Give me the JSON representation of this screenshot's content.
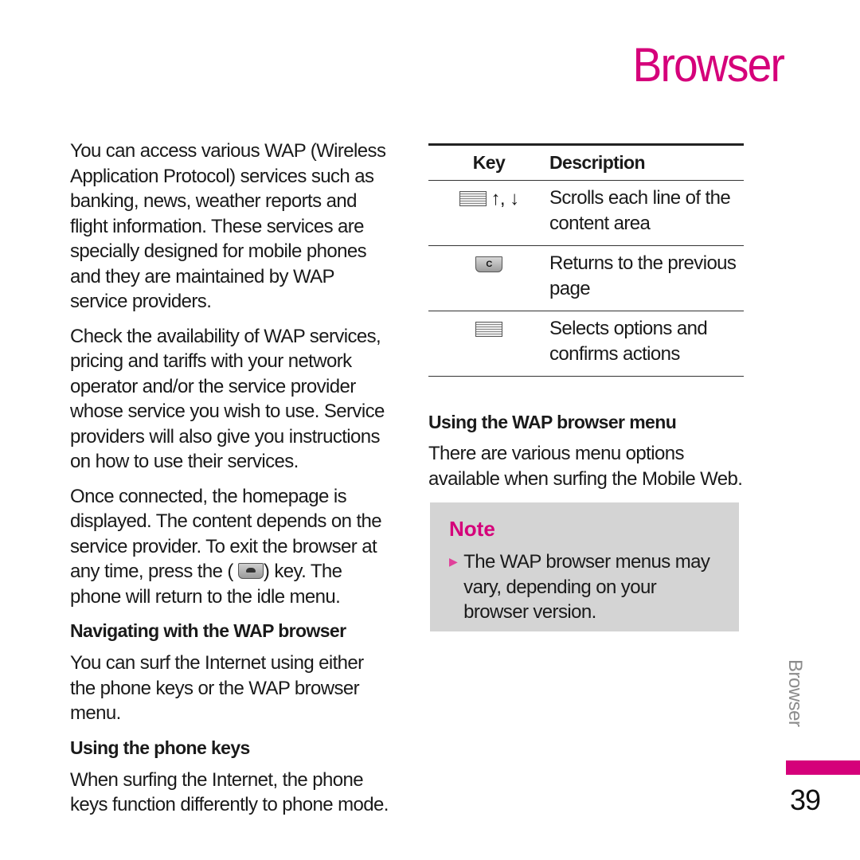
{
  "page": {
    "title": "Browser",
    "side_label": "Browser",
    "page_number": "39",
    "accent_color": "#d5007a"
  },
  "left": {
    "intro_1": "You can access various WAP (Wireless Application Protocol) services such as banking, news, weather reports and flight information. These services are specially designed for mobile phones and they are maintained by WAP service providers.",
    "intro_2": "Check the availability of WAP services, pricing and tariffs with your network operator and/or the service provider whose service you wish to use. Service providers will also give you instructions on how to use their services.",
    "intro_3_before": "Once connected, the homepage is displayed. The content depends on the service provider. To exit the browser at any time, press the (",
    "intro_3_key_icon": "end-call-key-icon",
    "intro_3_after": ") key. The phone will return to the idle menu.",
    "heading_navigating": "Navigating with the WAP browser",
    "navigating_text": "You can surf the Internet using either the phone keys or the WAP browser menu.",
    "heading_phone_keys": "Using the phone keys",
    "phone_keys_text": "When surfing the Internet, the phone keys function differently to phone mode."
  },
  "key_table": {
    "headers": {
      "key": "Key",
      "description": "Description"
    },
    "rows": [
      {
        "key_icon": "navigation-key-icon",
        "key_text": "↑, ↓",
        "description": "Scrolls each line of the content area"
      },
      {
        "key_icon": "clear-key-icon",
        "key_text": "C",
        "description": "Returns to the previous page"
      },
      {
        "key_icon": "ok-key-icon",
        "key_text": "",
        "description": "Selects options and confirms actions"
      }
    ]
  },
  "right": {
    "heading_menu": "Using the WAP browser menu",
    "menu_text": "There are various menu options available when surfing the Mobile Web."
  },
  "note": {
    "title": "Note",
    "bullet_icon": "triangle-bullet-icon",
    "text": "The WAP browser menus may vary, depending on your browser version."
  }
}
